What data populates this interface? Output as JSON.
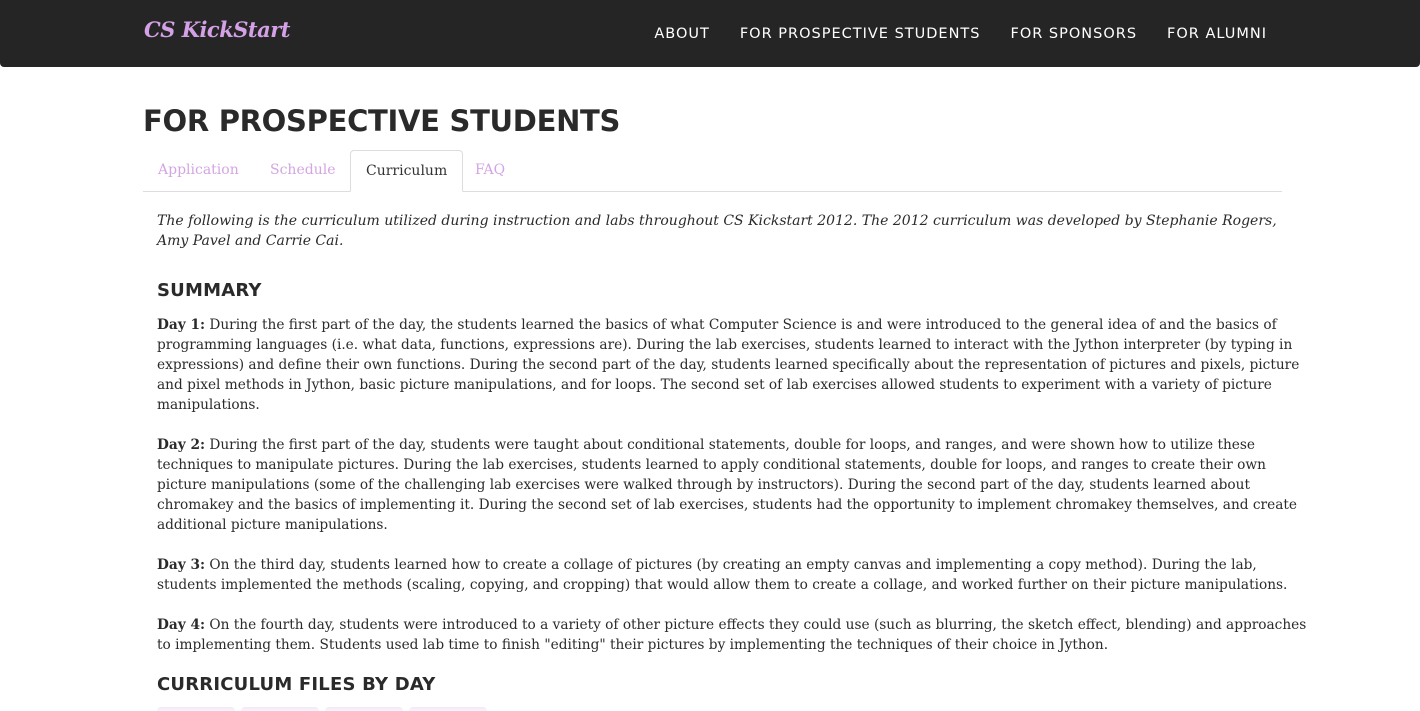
{
  "nav": {
    "brand": "CS KickStart",
    "links": [
      "ABOUT",
      "FOR PROSPECTIVE STUDENTS",
      "FOR SPONSORS",
      "FOR ALUMNI"
    ]
  },
  "page": {
    "title": "FOR PROSPECTIVE STUDENTS"
  },
  "tabs": {
    "items": [
      "Application",
      "Schedule",
      "Curriculum",
      "FAQ"
    ],
    "active": "Curriculum"
  },
  "content": {
    "intro": "The following is the curriculum utilized during instruction and labs throughout CS Kickstart 2012. The 2012 curriculum was developed by Stephanie Rogers, Amy Pavel and Carrie Cai.",
    "summary_heading": "SUMMARY",
    "days": [
      {
        "label": "Day 1:",
        "text": " During the first part of the day, the students learned the basics of what Computer Science is and were introduced to the general idea of and the basics of programming languages (i.e. what data, functions, expressions are). During the lab exercises, students learned to interact with the Jython interpreter (by typing in expressions) and define their own functions. During the second part of the day, students learned specifically about the representation of pictures and pixels, picture and pixel methods in Jython, basic picture manipulations, and for loops. The second set of lab exercises allowed students to experiment with a variety of picture manipulations."
      },
      {
        "label": "Day 2:",
        "text": " During the first part of the day, students were taught about conditional statements, double for loops, and ranges, and were shown how to utilize these techniques to manipulate pictures. During the lab exercises, students learned to apply conditional statements, double for loops, and ranges to create their own picture manipulations (some of the challenging lab exercises were walked through by instructors). During the second part of the day, students learned about chromakey and the basics of implementing it. During the second set of lab exercises, students had the opportunity to implement chromakey themselves, and create additional picture manipulations."
      },
      {
        "label": "Day 3:",
        "text": " On the third day, students learned how to create a collage of pictures (by creating an empty canvas and implementing a copy method). During the lab, students implemented the methods (scaling, copying, and cropping) that would allow them to create a collage, and worked further on their picture manipulations."
      },
      {
        "label": "Day 4:",
        "text": " On the fourth day, students were introduced to a variety of other picture effects they could use (such as blurring, the sketch effect, blending) and approaches to implementing them. Students used lab time to finish \"editing\" their pictures by implementing the techniques of their choice in Jython."
      }
    ],
    "files_heading": "CURRICULUM FILES BY DAY"
  },
  "colors": {
    "navbar_bg": "#252525",
    "brand": "#d4a0e6",
    "tab_link": "#d4a5e3",
    "file_button": "#d9b3e8"
  }
}
